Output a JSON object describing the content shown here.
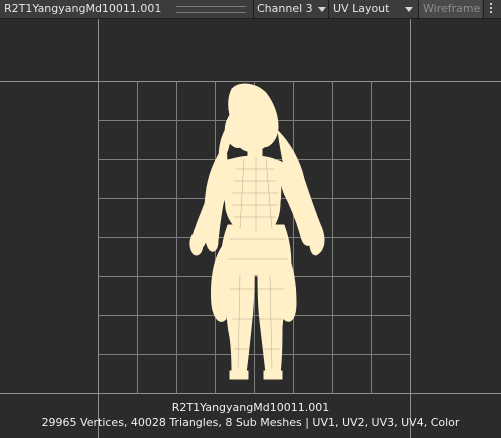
{
  "toolbar": {
    "title": "R2T1YangyangMd10011.001",
    "channel_label": "Channel 3",
    "view_mode_label": "UV Layout",
    "wireframe_label": "Wireframe",
    "more_icon": "kebab-menu-icon"
  },
  "viewport": {
    "mesh_name": "R2T1YangyangMd10011.001",
    "mesh_stats": "29965 Vertices, 40028 Triangles, 8 Sub Meshes | UV1, UV2, UV3, UV4, Color"
  },
  "colors": {
    "background": "#2b2b2b",
    "toolbar": "#3c3c3c",
    "grid_line": "#8a8a8a",
    "mesh_fill": "#fff0c8",
    "text": "#f0f0f0"
  }
}
